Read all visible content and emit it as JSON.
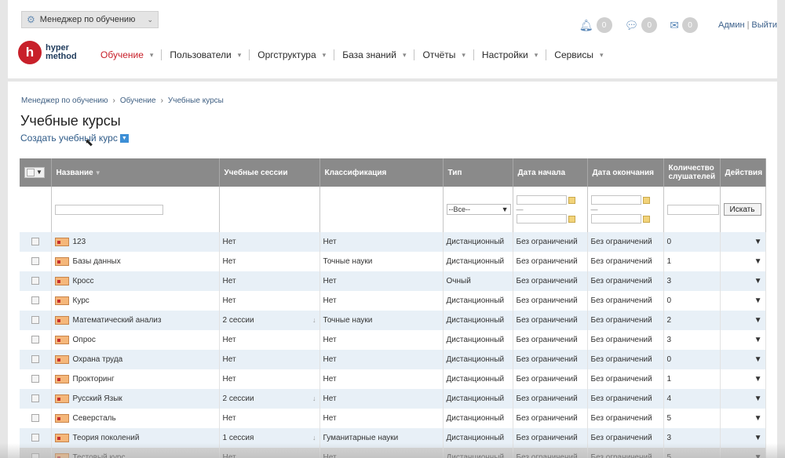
{
  "role_selector": {
    "label": "Менеджер по обучению"
  },
  "notifications": [
    {
      "icon": "bell-icon",
      "count": "0"
    },
    {
      "icon": "chat-icon",
      "count": "0"
    },
    {
      "icon": "mail-icon",
      "count": "0"
    }
  ],
  "user": {
    "name": "Админ",
    "logout": "Выйти"
  },
  "logo": {
    "mark": "h",
    "line1": "hyper",
    "line2": "method"
  },
  "nav": [
    {
      "label": "Обучение",
      "active": true
    },
    {
      "label": "Пользователи"
    },
    {
      "label": "Оргструктура"
    },
    {
      "label": "База знаний"
    },
    {
      "label": "Отчёты"
    },
    {
      "label": "Настройки"
    },
    {
      "label": "Сервисы"
    }
  ],
  "breadcrumb": [
    "Менеджер по обучению",
    "Обучение",
    "Учебные курсы"
  ],
  "page_title": "Учебные курсы",
  "create_link": "Создать учебный курс",
  "table": {
    "columns": [
      "Название",
      "Учебные сессии",
      "Классификация",
      "Тип",
      "Дата начала",
      "Дата окончания",
      "Количество слушателей",
      "Действия"
    ],
    "filters": {
      "type_select": "--Все--",
      "search_button": "Искать",
      "date_sep": "—"
    },
    "rows": [
      {
        "name": "123",
        "sessions": "Нет",
        "class": "Нет",
        "type": "Дистанционный",
        "start": "Без ограничений",
        "end": "Без ограничений",
        "count": "0",
        "expand": false
      },
      {
        "name": "Базы данных",
        "sessions": "Нет",
        "class": "Точные науки",
        "type": "Дистанционный",
        "start": "Без ограничений",
        "end": "Без ограничений",
        "count": "1",
        "expand": false
      },
      {
        "name": "Кросс",
        "sessions": "Нет",
        "class": "Нет",
        "type": "Очный",
        "start": "Без ограничений",
        "end": "Без ограничений",
        "count": "3",
        "expand": false
      },
      {
        "name": "Курс",
        "sessions": "Нет",
        "class": "Нет",
        "type": "Дистанционный",
        "start": "Без ограничений",
        "end": "Без ограничений",
        "count": "0",
        "expand": false
      },
      {
        "name": "Математический анализ",
        "sessions": "2 сессии",
        "class": "Точные науки",
        "type": "Дистанционный",
        "start": "Без ограничений",
        "end": "Без ограничений",
        "count": "2",
        "expand": true
      },
      {
        "name": "Опрос",
        "sessions": "Нет",
        "class": "Нет",
        "type": "Дистанционный",
        "start": "Без ограничений",
        "end": "Без ограничений",
        "count": "3",
        "expand": false
      },
      {
        "name": "Охрана труда",
        "sessions": "Нет",
        "class": "Нет",
        "type": "Дистанционный",
        "start": "Без ограничений",
        "end": "Без ограничений",
        "count": "0",
        "expand": false
      },
      {
        "name": "Прокторинг",
        "sessions": "Нет",
        "class": "Нет",
        "type": "Дистанционный",
        "start": "Без ограничений",
        "end": "Без ограничений",
        "count": "1",
        "expand": false
      },
      {
        "name": "Русский Язык",
        "sessions": "2 сессии",
        "class": "Нет",
        "type": "Дистанционный",
        "start": "Без ограничений",
        "end": "Без ограничений",
        "count": "4",
        "expand": true
      },
      {
        "name": "Северсталь",
        "sessions": "Нет",
        "class": "Нет",
        "type": "Дистанционный",
        "start": "Без ограничений",
        "end": "Без ограничений",
        "count": "5",
        "expand": false
      },
      {
        "name": "Теория поколений",
        "sessions": "1 сессия",
        "class": "Гуманитарные науки",
        "type": "Дистанционный",
        "start": "Без ограничений",
        "end": "Без ограничений",
        "count": "3",
        "expand": true
      },
      {
        "name": "Тестовый курс",
        "sessions": "Нет",
        "class": "Нет",
        "type": "Дистанционный",
        "start": "Без ограничений",
        "end": "Без ограничений",
        "count": "5",
        "expand": false
      }
    ]
  }
}
